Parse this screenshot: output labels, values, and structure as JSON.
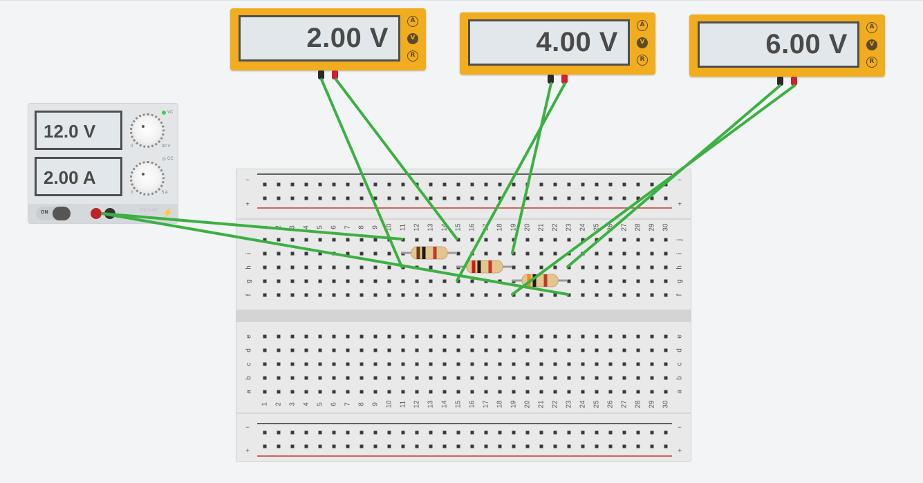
{
  "meters": [
    {
      "reading": "2.00 V",
      "modes": [
        "A",
        "V",
        "R"
      ],
      "active_mode": "V"
    },
    {
      "reading": "4.00 V",
      "modes": [
        "A",
        "V",
        "R"
      ],
      "active_mode": "V"
    },
    {
      "reading": "6.00 V",
      "modes": [
        "A",
        "V",
        "R"
      ],
      "active_mode": "V"
    }
  ],
  "power_supply": {
    "voltage_display": "12.0 V",
    "current_display": "2.00 A",
    "voltage_knob_min": "0",
    "voltage_knob_max": "30 V",
    "current_knob_min": "0",
    "current_knob_max": "5 A",
    "vc_label": "VC",
    "cc_label": "CC",
    "switch_label": "ON",
    "brand_label": "VOLTAGE"
  },
  "breadboard": {
    "columns": [
      "1",
      "2",
      "3",
      "4",
      "5",
      "6",
      "7",
      "8",
      "9",
      "10",
      "11",
      "12",
      "13",
      "14",
      "15",
      "16",
      "17",
      "18",
      "19",
      "20",
      "21",
      "22",
      "23",
      "24",
      "25",
      "26",
      "27",
      "28",
      "29",
      "30"
    ],
    "top_rows": [
      "j",
      "i",
      "h",
      "g",
      "f"
    ],
    "bottom_rows": [
      "e",
      "d",
      "c",
      "b",
      "a"
    ],
    "rail_minus": "−",
    "rail_plus": "+"
  },
  "resistors": [
    {
      "bands": [
        "#6b3a1c",
        "#1a1a1a",
        "#c0392b"
      ]
    },
    {
      "bands": [
        "#d01a1a",
        "#1a1a1a",
        "#c0392b"
      ]
    },
    {
      "bands": [
        "#f08a18",
        "#1a1a1a",
        "#c0392b"
      ]
    }
  ],
  "colors": {
    "meter_body": "#f2ad1e",
    "wire": "#3cb043",
    "lcd": "#e1e7ea",
    "rail_red": "#c0392b",
    "rail_black": "#333333"
  }
}
